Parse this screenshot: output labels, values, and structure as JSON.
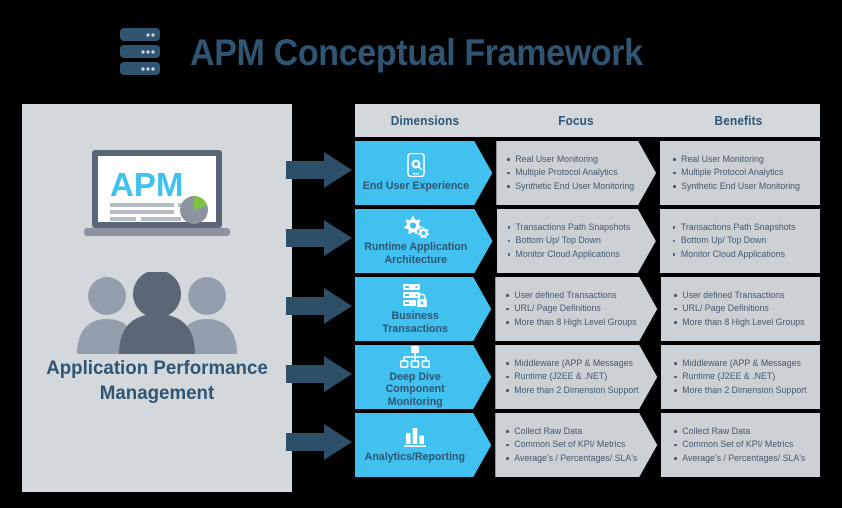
{
  "header": {
    "title": "APM Conceptual Framework",
    "logo_icon": "server-rack-icon"
  },
  "left_panel": {
    "screen_text": "APM",
    "caption_line1": "Application Performance",
    "caption_line2": "Management",
    "laptop_icon": "laptop-dashboard-icon",
    "people_icon": "three-people-icon",
    "pie_chart_icon": "pie-chart-icon"
  },
  "columns": {
    "dimensions": "Dimensions",
    "focus": "Focus",
    "benefits": "Benefits"
  },
  "colors": {
    "accent_blue": "#41c1ef",
    "dark_blue": "#2f5573",
    "arrow_blue": "#2e4f68",
    "panel_gray": "#d3d8dd",
    "cell_gray": "#ccd1d6",
    "text_gray": "#44586c",
    "background": "#000000",
    "pie_green": "#7dc242"
  },
  "rows": [
    {
      "dimension": "End User Experience",
      "icon": "smartphone-search-icon",
      "focus": [
        "Real User Monitoring",
        "Multiple Protocol Analytics",
        "Synthetic End User Monitoring"
      ],
      "benefits": [
        "Real User Monitoring",
        "Multiple Protocol Analytics",
        "Synthetic End User Monitoring"
      ]
    },
    {
      "dimension": "Runtime Application Architecture",
      "icon": "gears-icon",
      "focus": [
        "Transactions Path Snapshots",
        "Bottom Up/ Top Down",
        "Monitor Cloud Applications"
      ],
      "benefits": [
        "Transactions Path Snapshots",
        "Bottom Up/ Top Down",
        "Monitor Cloud Applications"
      ]
    },
    {
      "dimension": "Business Transactions",
      "icon": "server-lock-icon",
      "focus": [
        "User defined Transactions",
        "URL/ Page Definitions",
        "More than 8 High Level Groups"
      ],
      "benefits": [
        "User defined Transactions",
        "URL/ Page Definitions",
        "More than 8 High Level Groups"
      ]
    },
    {
      "dimension": "Deep Dive Component Monitoring",
      "icon": "sitemap-hierarchy-icon",
      "focus": [
        "Middleware (APP & Messages",
        "Runtime (J2EE & .NET)",
        "More than 2 Dimension Support"
      ],
      "benefits": [
        "Middleware (APP & Messages",
        "Runtime (J2EE & .NET)",
        "More than 2 Dimension Support"
      ]
    },
    {
      "dimension": "Analytics/Reporting",
      "icon": "bar-chart-icon",
      "focus": [
        "Collect Raw Data",
        "Common Set of KPI/ Metrics",
        "Average's  / Percentages/ SLA's"
      ],
      "benefits": [
        "Collect Raw Data",
        "Common Set of KPI/ Metrics",
        "Average's  / Percentages/ SLA's"
      ]
    }
  ]
}
